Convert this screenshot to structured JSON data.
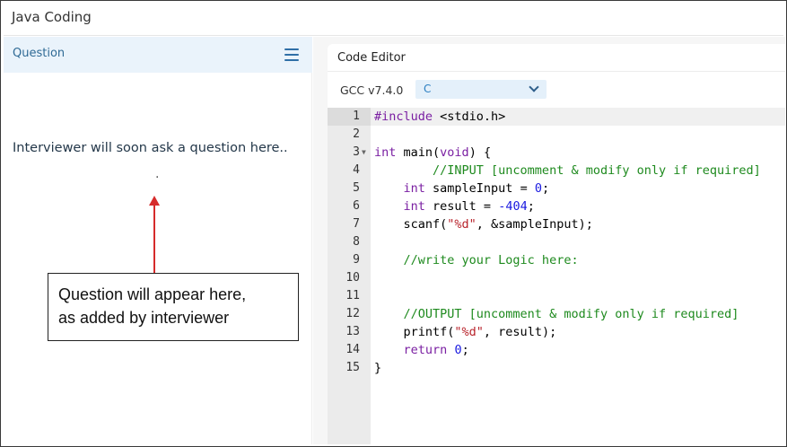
{
  "app": {
    "title": "Java Coding"
  },
  "question_panel": {
    "title": "Question",
    "menu_icon": "hamburger-menu-icon",
    "placeholder": "Interviewer will soon ask a question here..",
    "dot": "."
  },
  "annotation": {
    "line1": "Question will appear here,",
    "line2": "as added by interviewer",
    "arrow_color": "#d62b2b"
  },
  "editor": {
    "title": "Code Editor",
    "compiler": "GCC v7.4.0",
    "language": "C",
    "dropdown_icon": "chevron-down-icon",
    "fold_icon": "fold-arrow-icon",
    "line_numbers": [
      "1",
      "2",
      "3",
      "4",
      "5",
      "6",
      "7",
      "8",
      "9",
      "10",
      "11",
      "12",
      "13",
      "14",
      "15"
    ],
    "lines": [
      [
        {
          "t": "#include",
          "c": "kw"
        },
        {
          "t": " <stdio.h>",
          "c": ""
        }
      ],
      [],
      [
        {
          "t": "int",
          "c": "kw"
        },
        {
          "t": " main(",
          "c": ""
        },
        {
          "t": "void",
          "c": "kw"
        },
        {
          "t": ") {",
          "c": ""
        }
      ],
      [
        {
          "t": "        //INPUT [uncomment & modify only if required]",
          "c": "cmt"
        }
      ],
      [
        {
          "t": "    ",
          "c": ""
        },
        {
          "t": "int",
          "c": "kw"
        },
        {
          "t": " sampleInput = ",
          "c": ""
        },
        {
          "t": "0",
          "c": "num"
        },
        {
          "t": ";",
          "c": ""
        }
      ],
      [
        {
          "t": "    ",
          "c": ""
        },
        {
          "t": "int",
          "c": "kw"
        },
        {
          "t": " result = ",
          "c": ""
        },
        {
          "t": "-404",
          "c": "num"
        },
        {
          "t": ";",
          "c": ""
        }
      ],
      [
        {
          "t": "    scanf(",
          "c": ""
        },
        {
          "t": "\"%d\"",
          "c": "str"
        },
        {
          "t": ", &sampleInput);",
          "c": ""
        }
      ],
      [],
      [
        {
          "t": "    //write your Logic here:",
          "c": "cmt"
        }
      ],
      [],
      [],
      [
        {
          "t": "    //OUTPUT [uncomment & modify only if required]",
          "c": "cmt"
        }
      ],
      [
        {
          "t": "    printf(",
          "c": ""
        },
        {
          "t": "\"%d\"",
          "c": "str"
        },
        {
          "t": ", result);",
          "c": ""
        }
      ],
      [
        {
          "t": "    ",
          "c": ""
        },
        {
          "t": "return",
          "c": "kw"
        },
        {
          "t": " ",
          "c": ""
        },
        {
          "t": "0",
          "c": "num"
        },
        {
          "t": ";",
          "c": ""
        }
      ],
      [
        {
          "t": "}",
          "c": ""
        }
      ]
    ],
    "colors": {
      "keyword": "#7a1fa2",
      "number": "#1a1ae0",
      "string": "#b8232b",
      "comment": "#1e8a1e"
    }
  }
}
